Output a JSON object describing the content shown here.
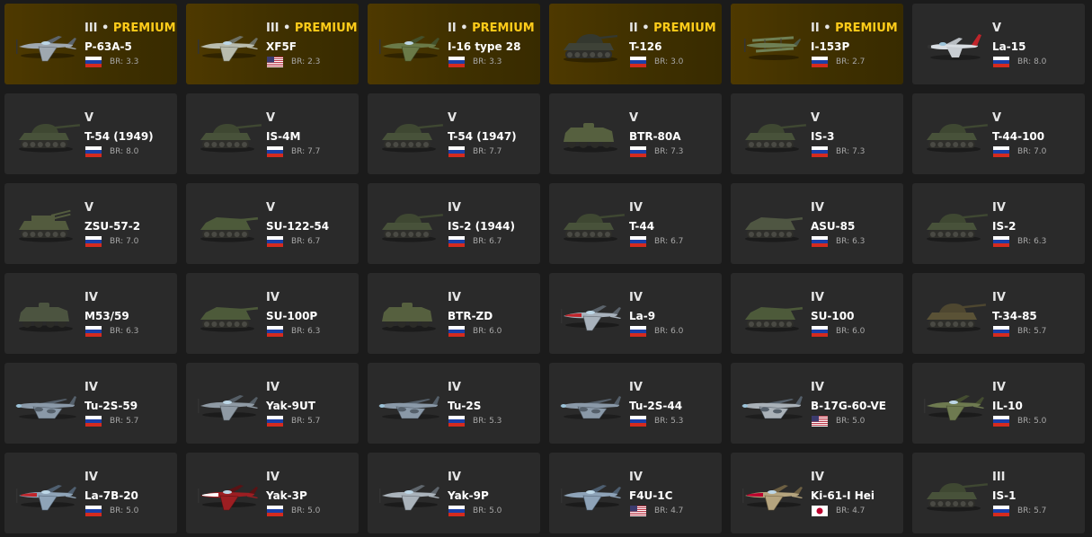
{
  "premium_label": "PREMIUM",
  "br_prefix": "BR:",
  "colors": {
    "card_bg": "#2a2a2a",
    "premium_bg": "#4e3900",
    "premium_text": "#ffcc1a",
    "page_bg": "#1b1b1b"
  },
  "vehicles": [
    {
      "rank": "III",
      "premium": true,
      "name": "P-63A-5",
      "nation": "ussr",
      "br": "3.3",
      "type": "plane",
      "icon": "p63-plane-icon"
    },
    {
      "rank": "III",
      "premium": true,
      "name": "XF5F",
      "nation": "usa",
      "br": "2.3",
      "type": "plane",
      "icon": "xf5f-plane-icon"
    },
    {
      "rank": "II",
      "premium": true,
      "name": "I-16 type 28",
      "nation": "ussr",
      "br": "3.3",
      "type": "plane",
      "icon": "i16-plane-icon"
    },
    {
      "rank": "II",
      "premium": true,
      "name": "T-126",
      "nation": "ussr",
      "br": "3.0",
      "type": "tank",
      "icon": "t126-tank-icon"
    },
    {
      "rank": "II",
      "premium": true,
      "name": "I-153P",
      "nation": "ussr",
      "br": "2.7",
      "type": "plane",
      "icon": "i153p-biplane-icon"
    },
    {
      "rank": "V",
      "premium": false,
      "name": "La-15",
      "nation": "ussr",
      "br": "8.0",
      "type": "jet",
      "icon": "la15-jet-icon"
    },
    {
      "rank": "V",
      "premium": false,
      "name": "T-54 (1949)",
      "nation": "ussr",
      "br": "8.0",
      "type": "tank",
      "icon": "t54-tank-icon"
    },
    {
      "rank": "V",
      "premium": false,
      "name": "IS-4M",
      "nation": "ussr",
      "br": "7.7",
      "type": "tank",
      "icon": "is4m-tank-icon"
    },
    {
      "rank": "V",
      "premium": false,
      "name": "T-54 (1947)",
      "nation": "ussr",
      "br": "7.7",
      "type": "tank",
      "icon": "t54-1947-tank-icon"
    },
    {
      "rank": "V",
      "premium": false,
      "name": "BTR-80A",
      "nation": "ussr",
      "br": "7.3",
      "type": "apc",
      "icon": "btr80a-apc-icon"
    },
    {
      "rank": "V",
      "premium": false,
      "name": "IS-3",
      "nation": "ussr",
      "br": "7.3",
      "type": "tank",
      "icon": "is3-tank-icon"
    },
    {
      "rank": "V",
      "premium": false,
      "name": "T-44-100",
      "nation": "ussr",
      "br": "7.0",
      "type": "tank",
      "icon": "t44-100-tank-icon"
    },
    {
      "rank": "V",
      "premium": false,
      "name": "ZSU-57-2",
      "nation": "ussr",
      "br": "7.0",
      "type": "spaa",
      "icon": "zsu57-spaa-icon"
    },
    {
      "rank": "V",
      "premium": false,
      "name": "SU-122-54",
      "nation": "ussr",
      "br": "6.7",
      "type": "td",
      "icon": "su122-td-icon"
    },
    {
      "rank": "IV",
      "premium": false,
      "name": "IS-2 (1944)",
      "nation": "ussr",
      "br": "6.7",
      "type": "tank",
      "icon": "is2-1944-tank-icon"
    },
    {
      "rank": "IV",
      "premium": false,
      "name": "T-44",
      "nation": "ussr",
      "br": "6.7",
      "type": "tank",
      "icon": "t44-tank-icon"
    },
    {
      "rank": "IV",
      "premium": false,
      "name": "ASU-85",
      "nation": "ussr",
      "br": "6.3",
      "type": "td",
      "icon": "asu85-td-icon"
    },
    {
      "rank": "IV",
      "premium": false,
      "name": "IS-2",
      "nation": "ussr",
      "br": "6.3",
      "type": "tank",
      "icon": "is2-tank-icon"
    },
    {
      "rank": "IV",
      "premium": false,
      "name": "M53/59",
      "nation": "ussr",
      "br": "6.3",
      "type": "apc",
      "icon": "m53-59-spaa-icon"
    },
    {
      "rank": "IV",
      "premium": false,
      "name": "SU-100P",
      "nation": "ussr",
      "br": "6.3",
      "type": "td",
      "icon": "su100p-td-icon"
    },
    {
      "rank": "IV",
      "premium": false,
      "name": "BTR-ZD",
      "nation": "ussr",
      "br": "6.0",
      "type": "apc",
      "icon": "btrzd-apc-icon"
    },
    {
      "rank": "IV",
      "premium": false,
      "name": "La-9",
      "nation": "ussr",
      "br": "6.0",
      "type": "plane",
      "icon": "la9-plane-icon"
    },
    {
      "rank": "IV",
      "premium": false,
      "name": "SU-100",
      "nation": "ussr",
      "br": "6.0",
      "type": "td",
      "icon": "su100-td-icon"
    },
    {
      "rank": "IV",
      "premium": false,
      "name": "T-34-85",
      "nation": "ussr",
      "br": "5.7",
      "type": "tank",
      "icon": "t34-85-tank-icon"
    },
    {
      "rank": "IV",
      "premium": false,
      "name": "Tu-2S-59",
      "nation": "ussr",
      "br": "5.7",
      "type": "bomber",
      "icon": "tu2s59-bomber-icon"
    },
    {
      "rank": "IV",
      "premium": false,
      "name": "Yak-9UT",
      "nation": "ussr",
      "br": "5.7",
      "type": "plane",
      "icon": "yak9ut-plane-icon"
    },
    {
      "rank": "IV",
      "premium": false,
      "name": "Tu-2S",
      "nation": "ussr",
      "br": "5.3",
      "type": "bomber",
      "icon": "tu2s-bomber-icon"
    },
    {
      "rank": "IV",
      "premium": false,
      "name": "Tu-2S-44",
      "nation": "ussr",
      "br": "5.3",
      "type": "bomber",
      "icon": "tu2s44-bomber-icon"
    },
    {
      "rank": "IV",
      "premium": false,
      "name": "B-17G-60-VE",
      "nation": "usa",
      "br": "5.0",
      "type": "heavy",
      "icon": "b17g-bomber-icon"
    },
    {
      "rank": "IV",
      "premium": false,
      "name": "IL-10",
      "nation": "ussr",
      "br": "5.0",
      "type": "plane",
      "icon": "il10-plane-icon"
    },
    {
      "rank": "IV",
      "premium": false,
      "name": "La-7B-20",
      "nation": "ussr",
      "br": "5.0",
      "type": "plane",
      "icon": "la7b20-plane-icon"
    },
    {
      "rank": "IV",
      "premium": false,
      "name": "Yak-3P",
      "nation": "ussr",
      "br": "5.0",
      "type": "plane",
      "icon": "yak3p-plane-icon"
    },
    {
      "rank": "IV",
      "premium": false,
      "name": "Yak-9P",
      "nation": "ussr",
      "br": "5.0",
      "type": "plane",
      "icon": "yak9p-plane-icon"
    },
    {
      "rank": "IV",
      "premium": false,
      "name": "F4U-1C",
      "nation": "usa",
      "br": "4.7",
      "type": "plane",
      "icon": "f4u1c-plane-icon"
    },
    {
      "rank": "IV",
      "premium": false,
      "name": "Ki-61-I Hei",
      "nation": "japan",
      "br": "4.7",
      "type": "plane",
      "icon": "ki61-plane-icon"
    },
    {
      "rank": "III",
      "premium": false,
      "name": "IS-1",
      "nation": "ussr",
      "br": "5.7",
      "type": "tank",
      "icon": "is1-tank-icon"
    }
  ]
}
